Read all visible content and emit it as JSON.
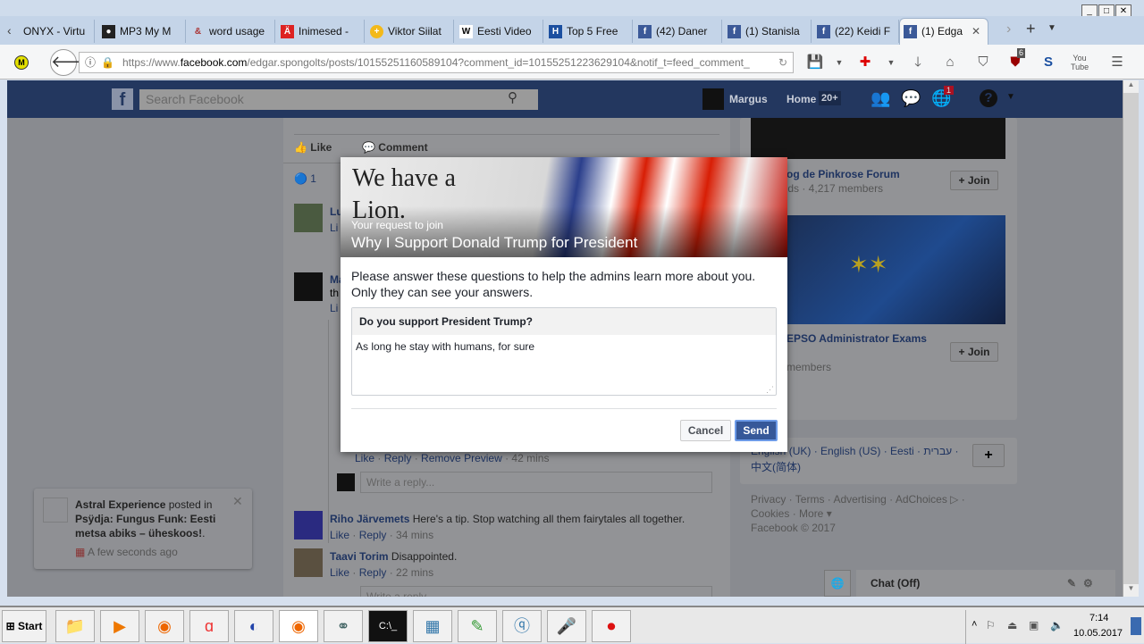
{
  "browser": {
    "tabs": [
      {
        "label": "ONYX - Virtu",
        "icon": "tab-scroll-left"
      },
      {
        "label": "MP3 My M",
        "icon": "mp3-icon"
      },
      {
        "label": "word usage",
        "icon": "word-icon"
      },
      {
        "label": "Inimesed -",
        "icon": "delfi-icon"
      },
      {
        "label": "Viktor Siilat",
        "icon": "star-icon"
      },
      {
        "label": "Eesti Video",
        "icon": "wikipedia-icon"
      },
      {
        "label": "Top 5 Free",
        "icon": "h-icon"
      },
      {
        "label": "(42) Daner",
        "icon": "facebook-icon"
      },
      {
        "label": "(1) Stanisla",
        "icon": "facebook-icon"
      },
      {
        "label": "(22) Keidi F",
        "icon": "facebook-icon"
      },
      {
        "label": "(1) Edga",
        "icon": "facebook-icon",
        "active": true
      }
    ],
    "url_prefix": "https://www.",
    "url_domain": "facebook.com",
    "url_path": "/edgar.spongolts/posts/10155251160589104?comment_id=10155251223629104&notif_t=feed_comment_",
    "ublock_count": "6"
  },
  "fb": {
    "search_placeholder": "Search Facebook",
    "user": "Margus",
    "home": "Home",
    "home_badge": "20+",
    "notif_badge": "1",
    "like": "Like",
    "comment": "Comment",
    "likes_count": "1",
    "comments": [
      {
        "name": "Lu",
        "text": "",
        "meta": "Li"
      },
      {
        "name": "Ma",
        "text": "th",
        "meta": "Li"
      },
      {
        "meta_links": [
          "Like",
          "Reply",
          "Remove Preview"
        ],
        "time": "42 mins"
      },
      {
        "name": "Riho Järvemets",
        "text": "Here's a tip. Stop watching all them fairytales all together.",
        "like": "Like",
        "reply": "Reply",
        "time": "34 mins"
      },
      {
        "name": "Taavi Torim",
        "text": "Disappointed.",
        "like": "Like",
        "reply": "Reply",
        "time": "22 mins"
      }
    ],
    "reply_placeholder": "Write a reply...",
    "groups": [
      {
        "name": "Blog de Pinkrose Forum",
        "meta": "ends · 4,217 members",
        "join": "+ Join"
      },
      {
        "name": "EPSO Administrator Exams",
        "meta": "members",
        "join": "+ Join"
      }
    ],
    "languages": "English (UK) · English (US) · Eesti · עברית ·",
    "languages2": "中文(简体)",
    "footer1": "Privacy · Terms · Advertising · AdChoices ▷ ·",
    "footer2": "Cookies · More ▾",
    "footer3": "Facebook © 2017",
    "chat": "Chat (Off)",
    "notification": {
      "actor": "Astral Experience",
      "verb": " posted in ",
      "target": "Psÿdja: Fungus Funk: Eesti metsa abiks – üheskoos!",
      "suffix": ".",
      "time": "A few seconds ago"
    }
  },
  "modal": {
    "hero_text1": "We have a",
    "hero_text2": "Lion.",
    "subtitle": "Your request to join",
    "title": "Why I Support Donald Trump for President",
    "intro": "Please answer these questions to help the admins learn more about you. Only they can see your answers.",
    "question": "Do you support President Trump?",
    "answer": "As long he stay with humans, for sure",
    "cancel": "Cancel",
    "send": "Send"
  },
  "taskbar": {
    "start": "Start",
    "time": "7:14",
    "date": "10.05.2017"
  }
}
